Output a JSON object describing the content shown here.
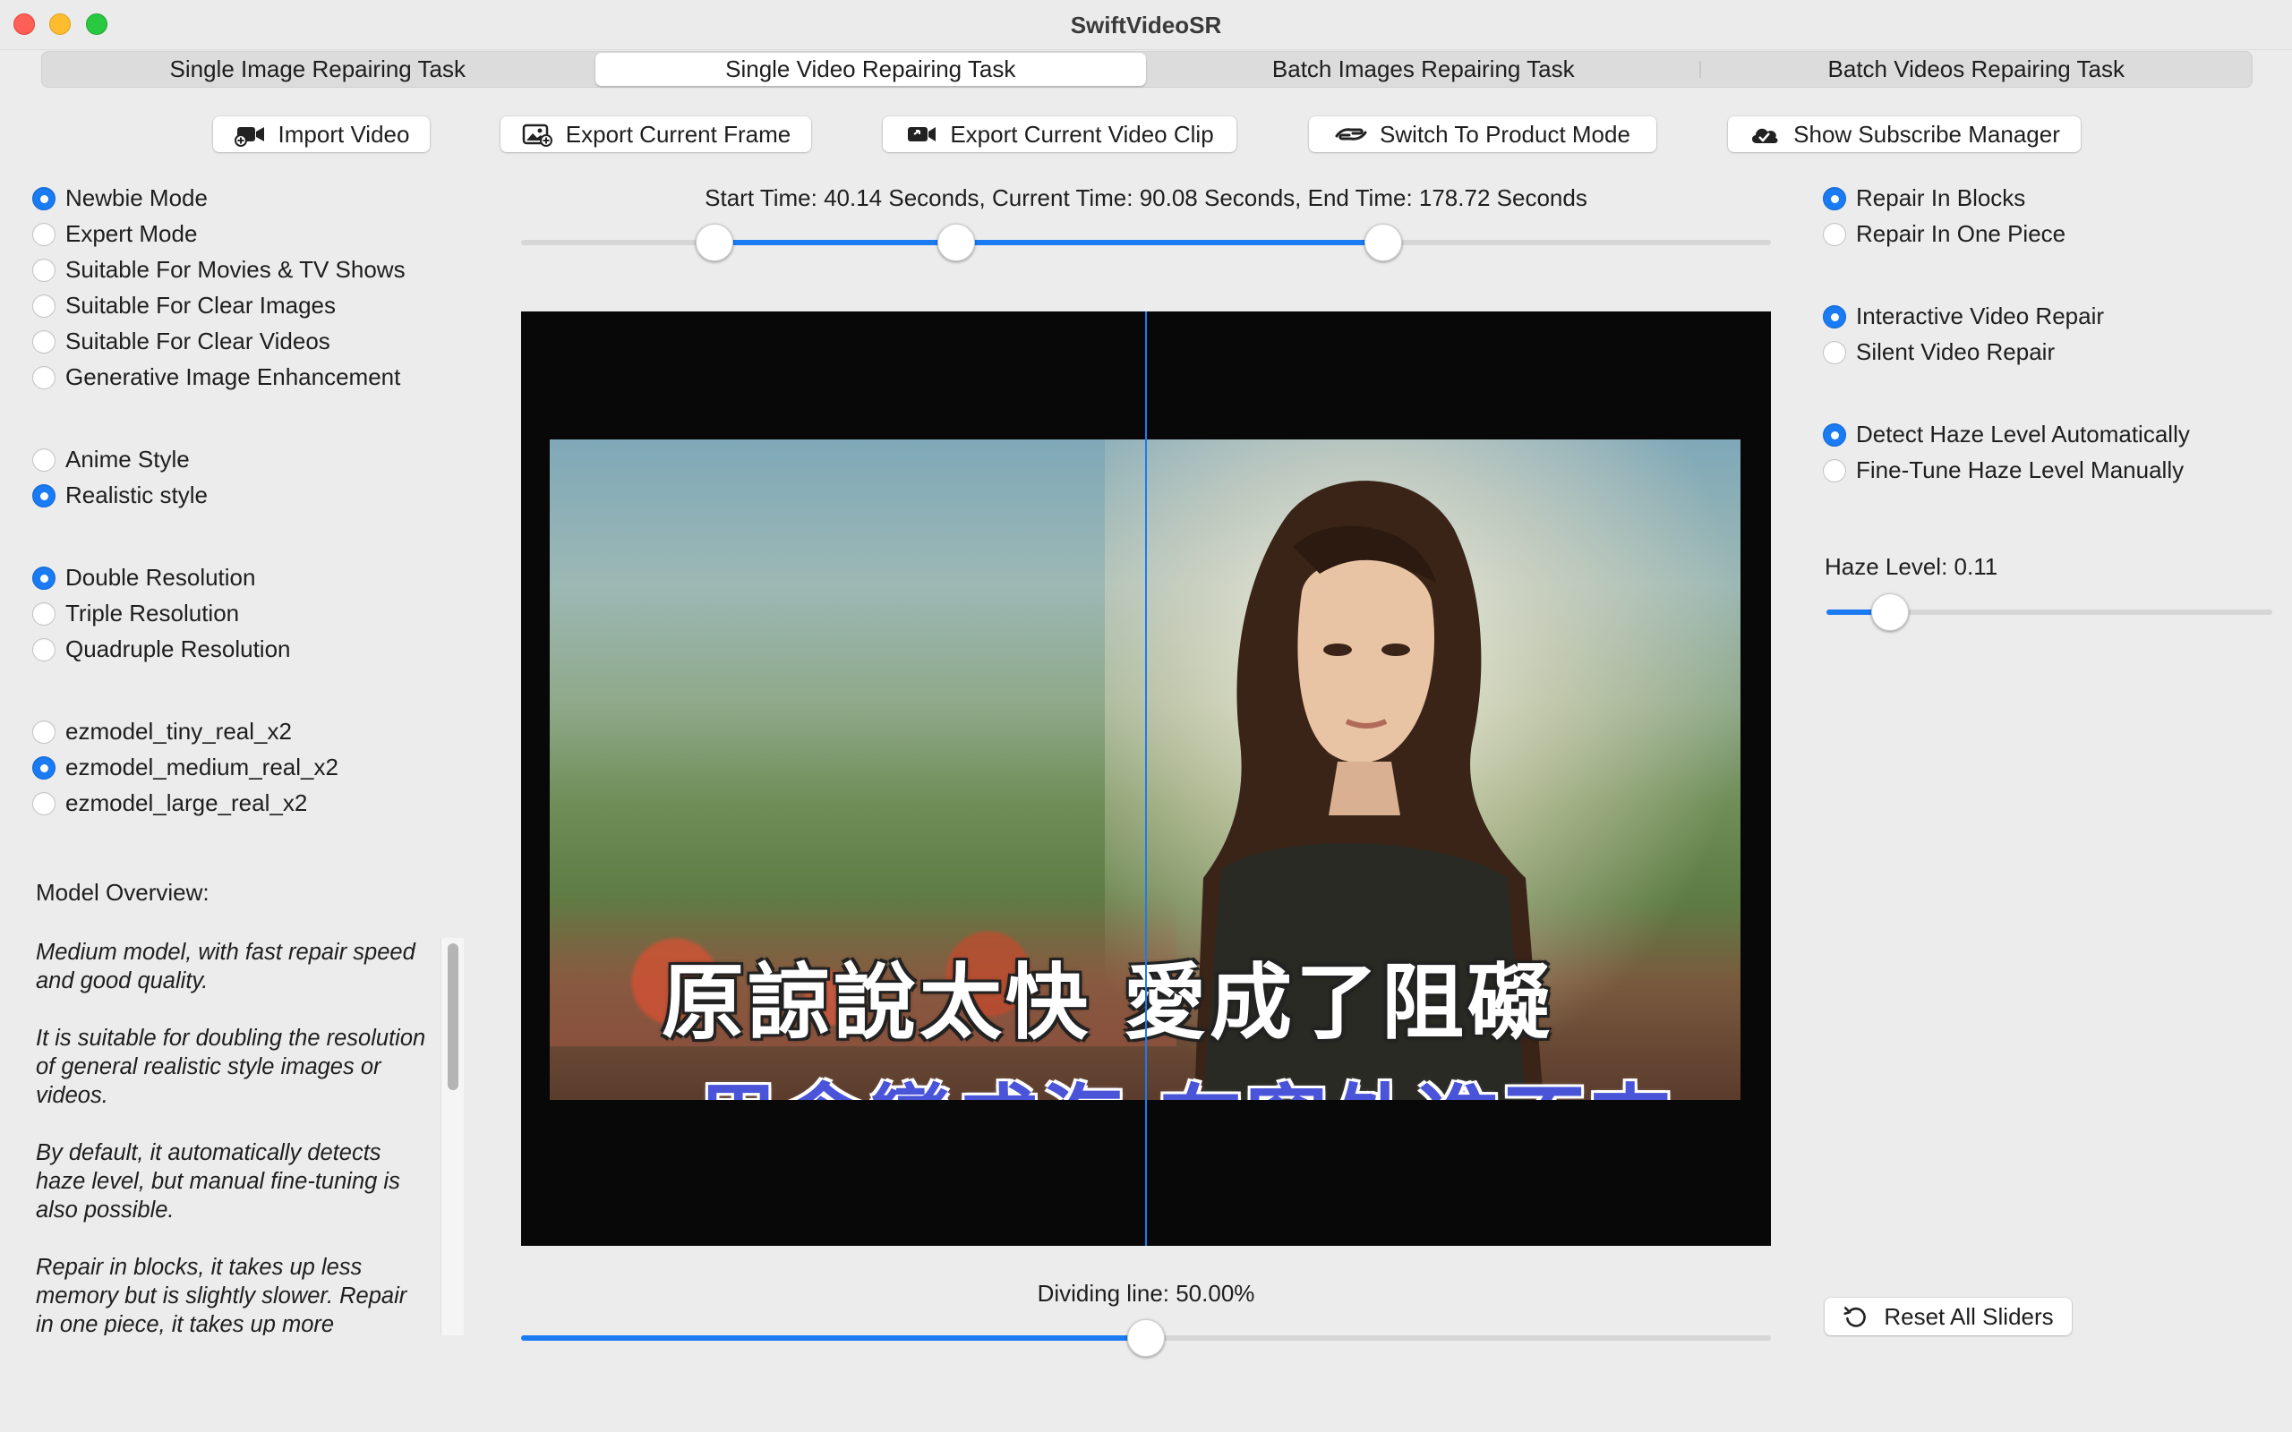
{
  "window": {
    "title": "SwiftVideoSR"
  },
  "tabs": [
    {
      "label": "Single Image Repairing Task",
      "active": false
    },
    {
      "label": "Single Video Repairing Task",
      "active": true
    },
    {
      "label": "Batch Images Repairing Task",
      "active": false
    },
    {
      "label": "Batch Videos Repairing Task",
      "active": false
    }
  ],
  "toolbar": {
    "import_video": {
      "label": "Import Video",
      "icon": "video-camera-plus-icon"
    },
    "export_frame": {
      "label": "Export Current Frame",
      "icon": "photo-export-icon"
    },
    "export_clip": {
      "label": "Export Current Video Clip",
      "icon": "video-export-icon"
    },
    "product_mode": {
      "label": "Switch To Product Mode",
      "icon": "hands-icon"
    },
    "subscribe": {
      "label": "Show Subscribe Manager",
      "icon": "cloud-check-icon"
    }
  },
  "left": {
    "mode_options": [
      {
        "label": "Newbie Mode",
        "selected": true
      },
      {
        "label": "Expert Mode",
        "selected": false
      },
      {
        "label": "Suitable For Movies & TV Shows",
        "selected": false
      },
      {
        "label": "Suitable For Clear Images",
        "selected": false
      },
      {
        "label": "Suitable For Clear Videos",
        "selected": false
      },
      {
        "label": "Generative Image Enhancement",
        "selected": false
      }
    ],
    "style_options": [
      {
        "label": "Anime Style",
        "selected": false
      },
      {
        "label": "Realistic style",
        "selected": true
      }
    ],
    "resolution_options": [
      {
        "label": "Double Resolution",
        "selected": true
      },
      {
        "label": "Triple Resolution",
        "selected": false
      },
      {
        "label": "Quadruple Resolution",
        "selected": false
      }
    ],
    "model_options": [
      {
        "label": "ezmodel_tiny_real_x2",
        "selected": false
      },
      {
        "label": "ezmodel_medium_real_x2",
        "selected": true
      },
      {
        "label": "ezmodel_large_real_x2",
        "selected": false
      }
    ],
    "overview_title": "Model Overview:",
    "overview_paragraphs": [
      "Medium model, with fast repair speed and good quality.",
      "It is suitable for doubling the resolution of general realistic style images or videos.",
      "By default, it automatically detects haze level, but manual fine-tuning is also possible.",
      "Repair in blocks, it takes up less memory but is slightly slower. Repair in one piece, it takes up more"
    ]
  },
  "center": {
    "time_label": "Start Time: 40.14 Seconds, Current Time: 90.08 Seconds, End Time: 178.72 Seconds",
    "time_values": {
      "start": 40.14,
      "current": 90.08,
      "end": 178.72,
      "total_max": 259.0
    },
    "subtitle_line1": "原諒說太快 愛成了阻礙",
    "subtitle_line2": "思念變成海 在窗外進不來",
    "dividing_label": "Dividing line: 50.00%",
    "dividing_value": 0.5
  },
  "right": {
    "repair_options": [
      {
        "label": "Repair In Blocks",
        "selected": true
      },
      {
        "label": "Repair In One Piece",
        "selected": false
      }
    ],
    "interaction_options": [
      {
        "label": "Interactive Video Repair",
        "selected": true
      },
      {
        "label": "Silent Video Repair",
        "selected": false
      }
    ],
    "haze_options": [
      {
        "label": "Detect Haze Level Automatically",
        "selected": true
      },
      {
        "label": "Fine-Tune Haze Level Manually",
        "selected": false
      }
    ],
    "haze_label": "Haze Level: 0.11",
    "haze_value": 0.11,
    "reset_label": "Reset All Sliders"
  },
  "colors": {
    "accent": "#1a7bf3",
    "background": "#ececec"
  }
}
